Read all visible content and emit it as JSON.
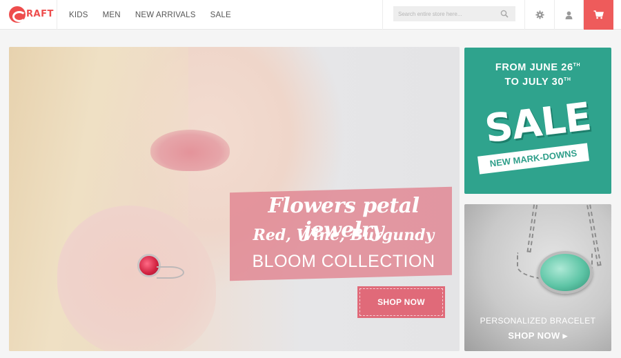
{
  "brand": {
    "logo_text": "RAFT"
  },
  "nav": {
    "items": [
      "KIDS",
      "MEN",
      "NEW ARRIVALS",
      "SALE"
    ]
  },
  "search": {
    "placeholder": "Search entire store here..."
  },
  "icons": {
    "search": "search-icon",
    "settings": "gear-icon",
    "account": "user-icon",
    "cart": "cart-icon"
  },
  "hero": {
    "headline": "Flowers petal jewelry",
    "subheadline": "Red, Wine, Burgundy",
    "collection": "BLOOM COLLECTION",
    "cta": "SHOP NOW"
  },
  "sale_promo": {
    "dates_line1": "FROM JUNE 26",
    "dates_line1_sup": "TH",
    "dates_line2": "TO JULY 30",
    "dates_line2_sup": "TH",
    "headline": "SALE",
    "tag": "NEW MARK-DOWNS"
  },
  "bracelet_promo": {
    "title": "PERSONALIZED BRACELET",
    "cta": "SHOP NOW ▸"
  },
  "colors": {
    "accent": "#ee5b5b",
    "hero_banner": "#e18591",
    "sale_teal": "#2fa38d"
  }
}
